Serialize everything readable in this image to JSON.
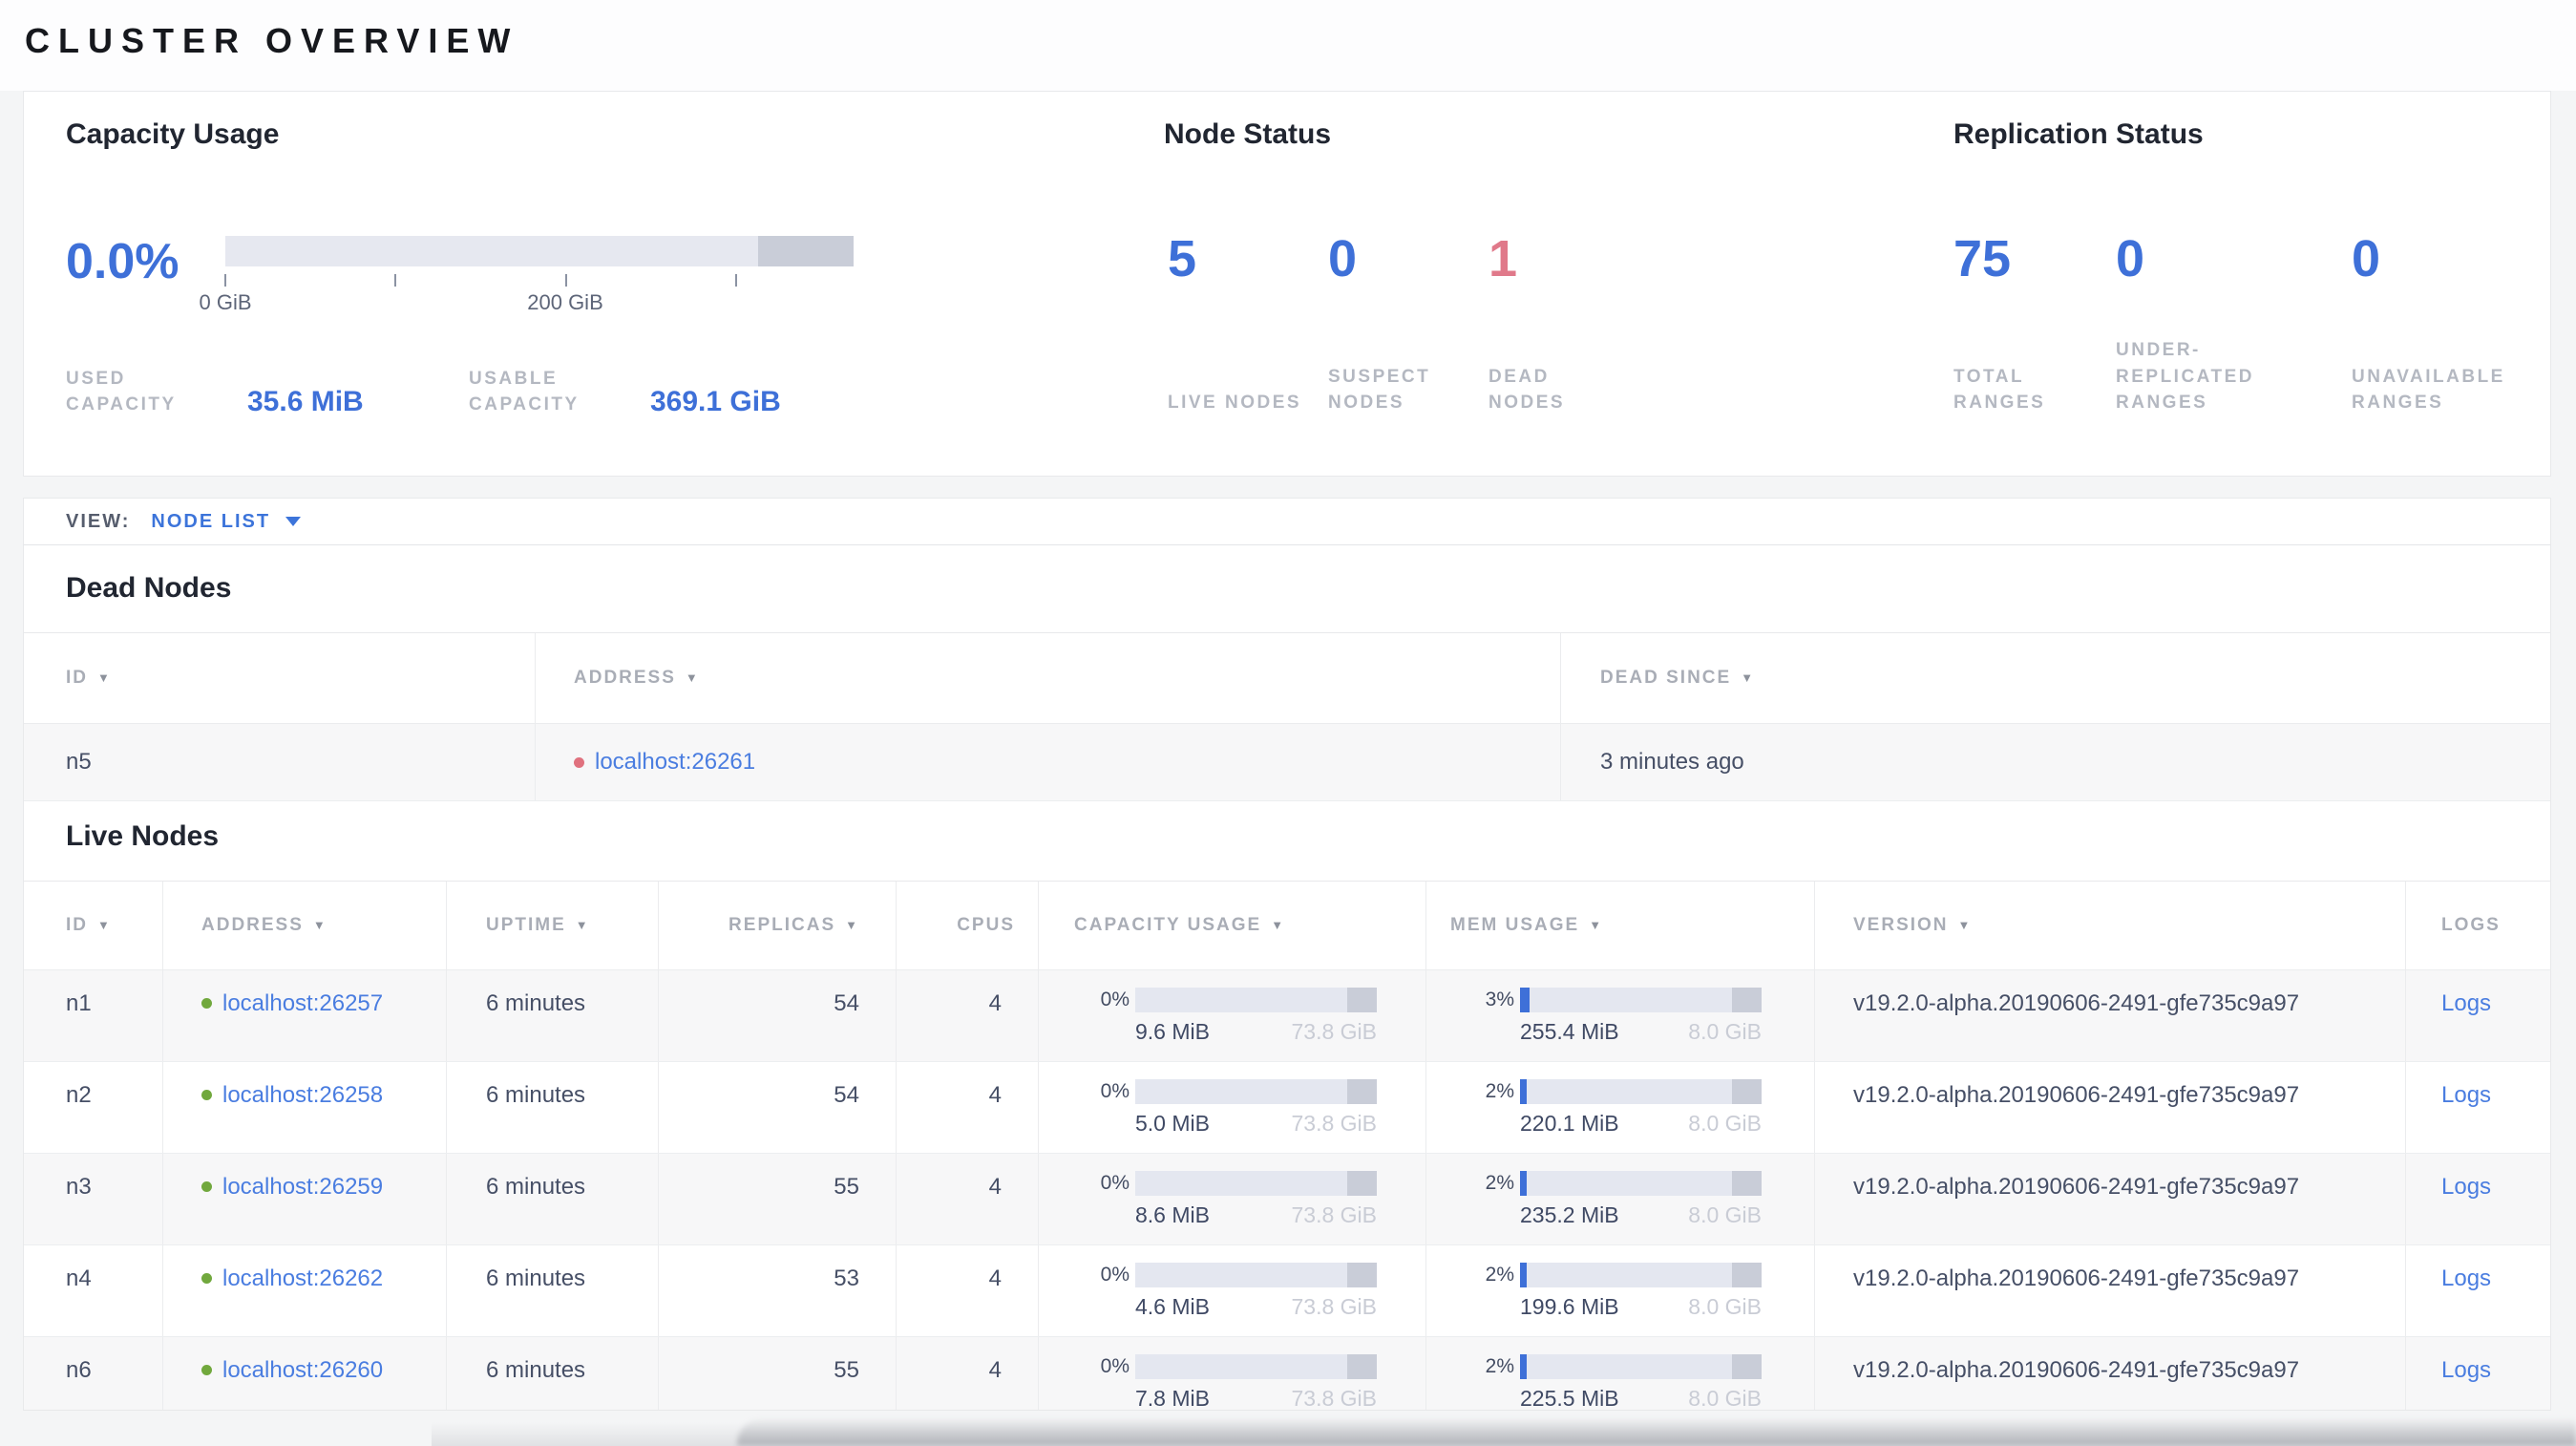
{
  "page": {
    "title": "CLUSTER OVERVIEW"
  },
  "colors": {
    "accent_blue": "#3e70d8",
    "link_blue": "#4a7de0",
    "dead_red": "#e0798a",
    "live_green": "#71a83d",
    "bar_track": "#e4e7f0",
    "bar_reserved": "#c9cdd8",
    "bar_fill": "#3e70d8"
  },
  "summary": {
    "capacity": {
      "title": "Capacity Usage",
      "percent": "0.0%",
      "tick_labels": [
        "0 GiB",
        "200 GiB"
      ],
      "used_label": "USED CAPACITY",
      "used_value": "35.6 MiB",
      "usable_label": "USABLE CAPACITY",
      "usable_value": "369.1 GiB"
    },
    "node_status": {
      "title": "Node Status",
      "stats": [
        {
          "value": "5",
          "label": "LIVE NODES",
          "status": "live"
        },
        {
          "value": "0",
          "label": "SUSPECT NODES",
          "status": "suspect"
        },
        {
          "value": "1",
          "label": "DEAD NODES",
          "status": "dead"
        }
      ]
    },
    "replication_status": {
      "title": "Replication Status",
      "stats": [
        {
          "value": "75",
          "label": "TOTAL RANGES"
        },
        {
          "value": "0",
          "label": "UNDER-REPLICATED RANGES"
        },
        {
          "value": "0",
          "label": "UNAVAILABLE RANGES"
        }
      ]
    }
  },
  "view_bar": {
    "label": "VIEW:",
    "selected": "NODE LIST"
  },
  "dead_nodes": {
    "title": "Dead Nodes",
    "columns": [
      {
        "label": "ID",
        "sortable": true
      },
      {
        "label": "ADDRESS",
        "sortable": true
      },
      {
        "label": "DEAD SINCE",
        "sortable": true
      }
    ],
    "rows": [
      {
        "id": "n5",
        "address": "localhost:26261",
        "dead_since": "3 minutes ago"
      }
    ]
  },
  "live_nodes": {
    "title": "Live Nodes",
    "columns": [
      {
        "label": "ID",
        "sortable": true
      },
      {
        "label": "ADDRESS",
        "sortable": true
      },
      {
        "label": "UPTIME",
        "sortable": true
      },
      {
        "label": "REPLICAS",
        "sortable": true
      },
      {
        "label": "CPUS",
        "sortable": false
      },
      {
        "label": "CAPACITY USAGE",
        "sortable": true
      },
      {
        "label": "MEM USAGE",
        "sortable": true
      },
      {
        "label": "VERSION",
        "sortable": true
      },
      {
        "label": "LOGS",
        "sortable": false
      }
    ],
    "rows": [
      {
        "id": "n1",
        "address": "localhost:26257",
        "uptime": "6 minutes",
        "replicas": "54",
        "cpus": "4",
        "capacity": {
          "percent": "0%",
          "used": "9.6 MiB",
          "total": "73.8 GiB",
          "fill": 0
        },
        "memory": {
          "percent": "3%",
          "used": "255.4 MiB",
          "total": "8.0 GiB",
          "fill": 3
        },
        "version": "v19.2.0-alpha.20190606-2491-gfe735c9a97",
        "logs": "Logs"
      },
      {
        "id": "n2",
        "address": "localhost:26258",
        "uptime": "6 minutes",
        "replicas": "54",
        "cpus": "4",
        "capacity": {
          "percent": "0%",
          "used": "5.0 MiB",
          "total": "73.8 GiB",
          "fill": 0
        },
        "memory": {
          "percent": "2%",
          "used": "220.1 MiB",
          "total": "8.0 GiB",
          "fill": 2
        },
        "version": "v19.2.0-alpha.20190606-2491-gfe735c9a97",
        "logs": "Logs"
      },
      {
        "id": "n3",
        "address": "localhost:26259",
        "uptime": "6 minutes",
        "replicas": "55",
        "cpus": "4",
        "capacity": {
          "percent": "0%",
          "used": "8.6 MiB",
          "total": "73.8 GiB",
          "fill": 0
        },
        "memory": {
          "percent": "2%",
          "used": "235.2 MiB",
          "total": "8.0 GiB",
          "fill": 2
        },
        "version": "v19.2.0-alpha.20190606-2491-gfe735c9a97",
        "logs": "Logs"
      },
      {
        "id": "n4",
        "address": "localhost:26262",
        "uptime": "6 minutes",
        "replicas": "53",
        "cpus": "4",
        "capacity": {
          "percent": "0%",
          "used": "4.6 MiB",
          "total": "73.8 GiB",
          "fill": 0
        },
        "memory": {
          "percent": "2%",
          "used": "199.6 MiB",
          "total": "8.0 GiB",
          "fill": 2
        },
        "version": "v19.2.0-alpha.20190606-2491-gfe735c9a97",
        "logs": "Logs"
      },
      {
        "id": "n6",
        "address": "localhost:26260",
        "uptime": "6 minutes",
        "replicas": "55",
        "cpus": "4",
        "capacity": {
          "percent": "0%",
          "used": "7.8 MiB",
          "total": "73.8 GiB",
          "fill": 0
        },
        "memory": {
          "percent": "2%",
          "used": "225.5 MiB",
          "total": "8.0 GiB",
          "fill": 2
        },
        "version": "v19.2.0-alpha.20190606-2491-gfe735c9a97",
        "logs": "Logs"
      }
    ]
  }
}
